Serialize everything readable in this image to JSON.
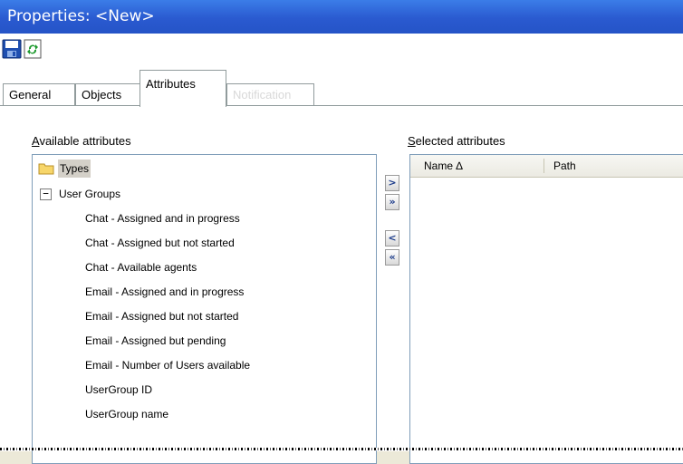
{
  "window": {
    "title": "Properties: <New>"
  },
  "toolbar": {
    "save_icon": "save-icon",
    "refresh_icon": "refresh-icon"
  },
  "tabs": [
    {
      "label": "General"
    },
    {
      "label": "Objects"
    },
    {
      "label": "Attributes"
    },
    {
      "label": "Notification"
    }
  ],
  "available": {
    "label_accel": "A",
    "label_rest": "vailable attributes",
    "root": {
      "label": "Types"
    },
    "group": {
      "label": "User Groups",
      "expander": "−"
    },
    "items": [
      "Chat - Assigned and in progress",
      "Chat - Assigned but not started",
      "Chat - Available agents",
      "Email - Assigned and in progress",
      "Email - Assigned but not started",
      "Email - Assigned but pending",
      "Email - Number of Users available",
      "UserGroup ID",
      "UserGroup name"
    ]
  },
  "buttons": {
    "add": ">",
    "add_all": "»",
    "remove": "<",
    "remove_all": "«"
  },
  "selected": {
    "label_accel": "S",
    "label_rest": "elected attributes",
    "columns": [
      {
        "label": "Name ∆"
      },
      {
        "label": "Path"
      }
    ]
  }
}
